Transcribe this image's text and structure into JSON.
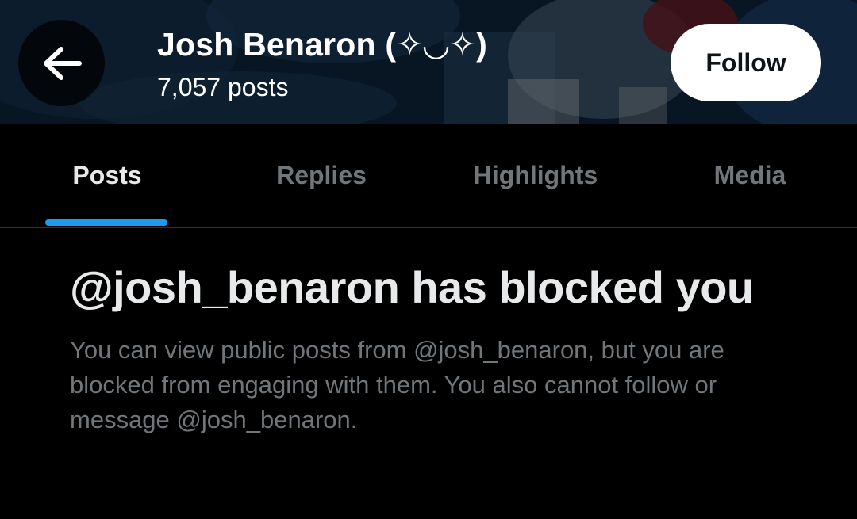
{
  "header": {
    "display_name": "Josh Benaron (✧◡✧)",
    "post_count": "7,057 posts",
    "back_icon": "arrow-left-icon",
    "follow_label": "Follow"
  },
  "tabs": [
    {
      "label": "Posts",
      "active": true
    },
    {
      "label": "Replies",
      "active": false
    },
    {
      "label": "Highlights",
      "active": false
    },
    {
      "label": "Media",
      "active": false
    }
  ],
  "blocked": {
    "title": "@josh_benaron has blocked you",
    "description": "You can view public posts from @josh_benaron, but you are blocked from engaging with them. You also cannot follow or message @josh_benaron."
  },
  "colors": {
    "background": "#000000",
    "accent": "#1d9bf0",
    "primary_text": "#e7e9ea",
    "secondary_text": "#71767b"
  }
}
